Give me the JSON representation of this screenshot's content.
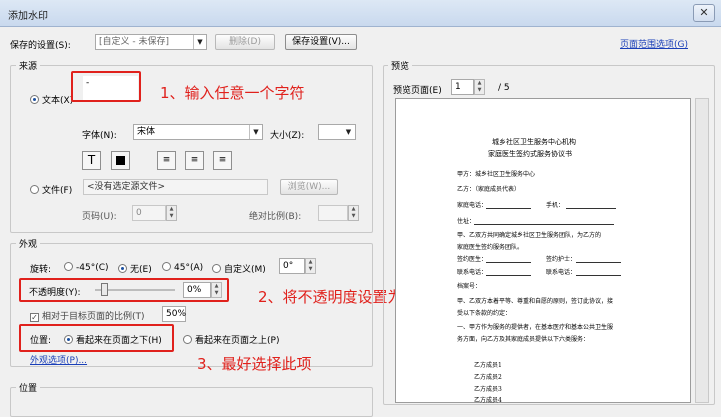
{
  "title": "添加水印",
  "close": "✕",
  "top": {
    "saved_label": "保存的设置(S):",
    "saved_value": "[自定义 - 未保存]",
    "delete": "删除(D)",
    "save": "保存设置(V)...",
    "range_link": "页面范围选项(G)"
  },
  "source": {
    "group": "来源",
    "text_radio": "文本(X)",
    "text_value": "-",
    "font_label": "字体(N):",
    "font_value": "宋体",
    "size_label": "大小(Z):",
    "file_radio": "文件(F)",
    "file_value": "<没有选定源文件>",
    "browse": "浏览(W)...",
    "page_label": "页码(U):",
    "page_value": "0",
    "scale_label": "绝对比例(B):"
  },
  "appearance": {
    "group": "外观",
    "rotate_label": "旋转:",
    "rot1": "-45°(C)",
    "rot2": "无(E)",
    "rot3": "45°(A)",
    "rot4": "自定义(M)",
    "rot_value": "0°",
    "opacity_label": "不透明度(Y):",
    "opacity_value": "0%",
    "relative_label": "相对于目标页面的比例(T)",
    "relative_value": "50%",
    "position_label": "位置:",
    "pos1": "看起来在页面之下(H)",
    "pos2": "看起来在页面之上(P)",
    "more_link": "外观选项(P)..."
  },
  "location": {
    "group": "位置"
  },
  "preview": {
    "group": "预览",
    "page_label": "预览页面(E)",
    "page_value": "1",
    "total": "/ 5"
  },
  "annotations": {
    "a1": "1、输入任意一个字符",
    "a2": "2、将不透明度设置为0",
    "a3": "3、最好选择此项"
  },
  "doc": {
    "title1": "城乡社区卫生服务中心机构",
    "title2": "家庭医生签约式服务协议书",
    "lines": [
      "甲方：城乡社区卫生服务中心",
      "乙方：（家庭成员代表）",
      "家庭电话：",
      "手机：",
      "住址：",
      "甲、乙双方共同确定城乡社区卫生服务团队，为乙方的",
      "家庭医生签约服务团队。",
      "签约医生：",
      "签约护士：",
      "联系电话：",
      "联系电话：",
      "档案号：",
      "甲、乙双方本着平等、尊重和自愿的原则，签订此协议，接",
      "受以下条款的约定：",
      "一、甲方作为服务的提供者，在基本医疗和基本公共卫生服",
      "务方面，向乙方及其家庭成员提供以下六类服务：",
      "乙方成员1",
      "乙方成员2",
      "乙方成员3",
      "乙方成员4"
    ]
  },
  "icons": {
    "checked": "✓",
    "dropdown": "▼",
    "up": "▲",
    "down": "▼"
  }
}
